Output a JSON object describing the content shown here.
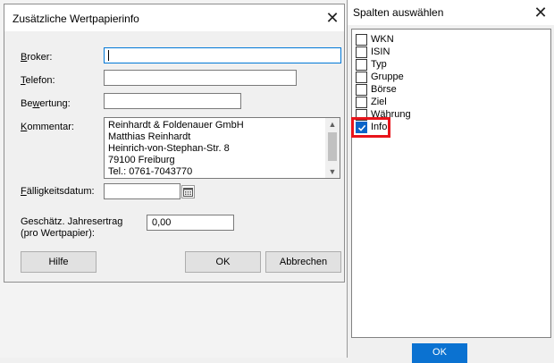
{
  "dialog1": {
    "title": "Zusätzliche Wertpapierinfo",
    "close_glyph": "✕",
    "fields": {
      "broker": {
        "label_u": "B",
        "label_rest": "roker:",
        "value": ""
      },
      "telefon": {
        "label_u": "T",
        "label_rest": "elefon:",
        "value": ""
      },
      "bewertung": {
        "label_pre": "Be",
        "label_u": "w",
        "label_rest": "ertung:",
        "value": ""
      },
      "kommentar": {
        "label_u": "K",
        "label_rest": "ommentar:"
      },
      "faelligkeit": {
        "label_u": "F",
        "label_rest": "älligkeitsdatum:",
        "value": ""
      },
      "jahresertrag": {
        "label_line1": "Geschätz. Jahresertrag",
        "label_line2": "(pro Wertpapier):",
        "value": "0,00"
      }
    },
    "comment_lines": [
      "Reinhardt & Foldenauer GmbH",
      "Matthias Reinhardt",
      "Heinrich-von-Stephan-Str. 8",
      "79100 Freiburg",
      "Tel.: 0761-7043770"
    ],
    "buttons": {
      "help": "Hilfe",
      "ok": "OK",
      "cancel": "Abbrechen"
    }
  },
  "dialog2": {
    "title": "Spalten auswählen",
    "close_glyph": "✕",
    "columns": [
      {
        "label": "WKN",
        "checked": false
      },
      {
        "label": "ISIN",
        "checked": false
      },
      {
        "label": "Typ",
        "checked": false
      },
      {
        "label": "Gruppe",
        "checked": false
      },
      {
        "label": "Börse",
        "checked": false
      },
      {
        "label": "Ziel",
        "checked": false
      },
      {
        "label": "Währung",
        "checked": false
      },
      {
        "label": "Info",
        "checked": true
      }
    ],
    "highlight_color": "#e8141b",
    "ok_label": "OK"
  }
}
